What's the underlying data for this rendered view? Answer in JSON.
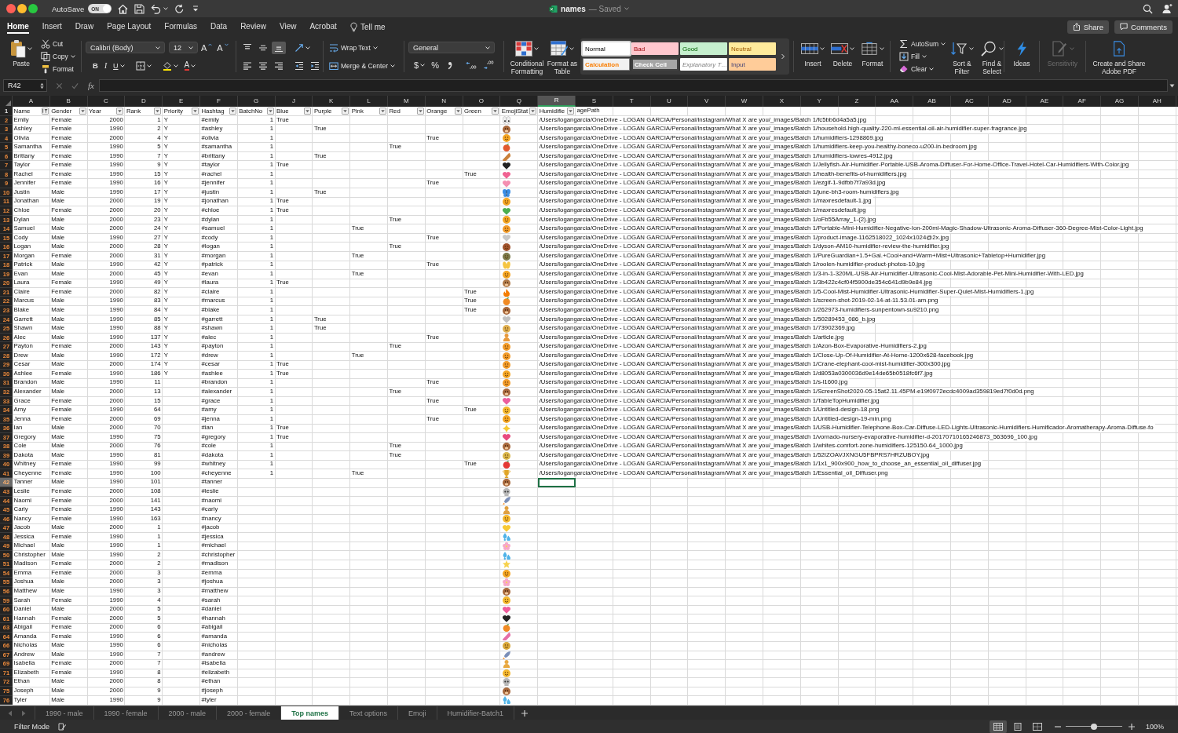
{
  "title_bar": {
    "autosave_label": "AutoSave",
    "autosave": {
      "label": "ON",
      "on": true
    },
    "document": "names",
    "status": "— Saved"
  },
  "ribbon_tabs": [
    {
      "label": "Home",
      "selected": true
    },
    {
      "label": "Insert",
      "selected": false
    },
    {
      "label": "Draw",
      "selected": false
    },
    {
      "label": "Page Layout",
      "selected": false
    },
    {
      "label": "Formulas",
      "selected": false
    },
    {
      "label": "Data",
      "selected": false
    },
    {
      "label": "Review",
      "selected": false
    },
    {
      "label": "View",
      "selected": false
    },
    {
      "label": "Acrobat",
      "selected": false
    }
  ],
  "tell_me": "Tell me",
  "share": "Share",
  "comments": "Comments",
  "clipboard": {
    "paste": "Paste",
    "cut": "Cut",
    "copy": "Copy",
    "format": "Format"
  },
  "font": {
    "name": "Calibri (Body)",
    "size": "12",
    "grow": "A",
    "shrink": "A",
    "bold": "B",
    "italic": "I",
    "underline": "U",
    "font_color_button": "A"
  },
  "alignment": {
    "vertical": [
      {
        "kind": "top",
        "selected": false
      },
      {
        "kind": "middle",
        "selected": false
      },
      {
        "kind": "bottom",
        "selected": true
      }
    ],
    "horizontal": [
      {
        "kind": "left",
        "selected": false
      },
      {
        "kind": "center",
        "selected": false
      },
      {
        "kind": "right",
        "selected": false
      }
    ],
    "wrap_text": "Wrap Text",
    "merge": "Merge & Center"
  },
  "number": {
    "format": "General",
    "currency": "$",
    "percent": "%"
  },
  "format_buttons": {
    "conditional": "Conditional Formatting",
    "table": "Format as Table"
  },
  "cell_styles": [
    {
      "label": "Normal",
      "kind": "normal",
      "selected": true
    },
    {
      "label": "Bad",
      "kind": "bad",
      "selected": false
    },
    {
      "label": "Good",
      "kind": "good",
      "selected": false
    },
    {
      "label": "Neutral",
      "kind": "neutral",
      "selected": false
    },
    {
      "label": "Calculation",
      "kind": "calculation",
      "selected": false
    },
    {
      "label": "Check Cell",
      "kind": "check",
      "selected": false
    },
    {
      "label": "Explanatory T…",
      "kind": "explanatory",
      "selected": false
    },
    {
      "label": "Input",
      "kind": "input",
      "selected": false
    }
  ],
  "cells": {
    "insert": "Insert",
    "delete": "Delete",
    "format": "Format"
  },
  "editing": {
    "autosum": "AutoSum",
    "fill": "Fill",
    "clear": "Clear",
    "sort": "Sort & Filter",
    "find": "Find & Select"
  },
  "tools": [
    {
      "label": "Ideas",
      "kind": "ideas",
      "disabled": false
    },
    {
      "label": "Sensitivity",
      "kind": "sensitivity",
      "disabled": true
    },
    {
      "label": "Create and Share Adobe PDF",
      "kind": "pdf",
      "disabled": false
    }
  ],
  "formula_bar": {
    "name_box": "R42",
    "fx": "fx",
    "edit_buttons_disabled": true
  },
  "columns": [
    {
      "label": "A",
      "selected": false
    },
    {
      "label": "B",
      "selected": false
    },
    {
      "label": "C",
      "selected": false
    },
    {
      "label": "D",
      "selected": false
    },
    {
      "label": "E",
      "selected": false
    },
    {
      "label": "F",
      "selected": false
    },
    {
      "label": "G",
      "selected": false
    },
    {
      "label": "J",
      "selected": false
    },
    {
      "label": "K",
      "selected": false
    },
    {
      "label": "L",
      "selected": false
    },
    {
      "label": "M",
      "selected": false
    },
    {
      "label": "N",
      "selected": false
    },
    {
      "label": "O",
      "selected": false
    },
    {
      "label": "Q",
      "selected": false
    },
    {
      "label": "R",
      "selected": true
    },
    {
      "label": "S",
      "selected": false
    },
    {
      "label": "T",
      "selected": false
    },
    {
      "label": "U",
      "selected": false
    },
    {
      "label": "V",
      "selected": false
    },
    {
      "label": "W",
      "selected": false
    },
    {
      "label": "X",
      "selected": false
    },
    {
      "label": "Y",
      "selected": false
    },
    {
      "label": "Z",
      "selected": false
    },
    {
      "label": "AA",
      "selected": false
    },
    {
      "label": "AB",
      "selected": false
    },
    {
      "label": "AC",
      "selected": false
    },
    {
      "label": "AD",
      "selected": false
    },
    {
      "label": "AE",
      "selected": false
    },
    {
      "label": "AF",
      "selected": false
    },
    {
      "label": "AG",
      "selected": false
    },
    {
      "label": "AH",
      "selected": false
    }
  ],
  "header_row": {
    "row": "1",
    "cells": [
      {
        "label": "Name",
        "filtered": true
      },
      {
        "label": "Gender",
        "filtered": false
      },
      {
        "label": "Year",
        "filtered": false
      },
      {
        "label": "Rank",
        "filtered": false
      },
      {
        "label": "Priority",
        "filtered": false
      },
      {
        "label": "Hashtag",
        "filtered": false
      },
      {
        "label": "BatchNo",
        "filtered": false
      },
      {
        "label": "Blue",
        "filtered": false
      },
      {
        "label": "Purple",
        "filtered": false
      },
      {
        "label": "Pink",
        "filtered": false
      },
      {
        "label": "Red",
        "filtered": false
      },
      {
        "label": "Orange",
        "filtered": false
      },
      {
        "label": "Green",
        "filtered": false
      },
      {
        "label": "EmojiStat",
        "filtered": false
      },
      {
        "label": "Humidifie",
        "filtered": false,
        "overflow": "agePath"
      }
    ]
  },
  "rows": [
    {
      "row": "2",
      "name": "Emily",
      "gender": "Female",
      "year": "2000",
      "rank": "1",
      "priority": "Y",
      "hashtag": "#emily",
      "batch_no": "1",
      "blue": "True",
      "emoji": {
        "kind": "eyes",
        "color": "#f2f2f2"
      },
      "image_path": "/Users/logangarcia/OneDrive - LOGAN GARCIA/Personal/Instagram/What X are you/_images/Batch 1/fc5bb6d4a5a5.jpg",
      "selected": false
    },
    {
      "row": "3",
      "name": "Ashley",
      "gender": "Female",
      "year": "1990",
      "rank": "2",
      "priority": "Y",
      "hashtag": "#ashley",
      "batch_no": "1",
      "purple": "True",
      "emoji": {
        "kind": "monkey",
        "color": "#a8683c"
      },
      "image_path": "/Users/logangarcia/OneDrive - LOGAN GARCIA/Personal/Instagram/What X are you/_images/Batch 1/household-high-quality-220-ml-essential-oil-air-humidifier-super-fragrance.jpg",
      "selected": false
    },
    {
      "row": "4",
      "name": "Olivia",
      "gender": "Female",
      "year": "2000",
      "rank": "4",
      "priority": "Y",
      "hashtag": "#olivia",
      "batch_no": "1",
      "orange": "True",
      "emoji": {
        "kind": "face",
        "color": "#f5a623"
      },
      "image_path": "/Users/logangarcia/OneDrive - LOGAN GARCIA/Personal/Instagram/What X are you/_images/Batch 1/humidifiers-1298869.jpg",
      "selected": false
    },
    {
      "row": "5",
      "name": "Samantha",
      "gender": "Female",
      "year": "1990",
      "rank": "5",
      "priority": "Y",
      "hashtag": "#samantha",
      "batch_no": "1",
      "red": "True",
      "emoji": {
        "kind": "fruit",
        "color": "#e25a2e"
      },
      "image_path": "/Users/logangarcia/OneDrive - LOGAN GARCIA/Personal/Instagram/What X are you/_images/Batch 1/humidifiers-keep-you-healthy-boneco-u200-in-bedroom.jpg",
      "selected": false
    },
    {
      "row": "6",
      "name": "Brittany",
      "gender": "Female",
      "year": "1990",
      "rank": "7",
      "priority": "Y",
      "hashtag": "#brittany",
      "batch_no": "1",
      "purple": "True",
      "emoji": {
        "kind": "sticks",
        "color": "#c9803a"
      },
      "image_path": "/Users/logangarcia/OneDrive - LOGAN GARCIA/Personal/Instagram/What X are you/_images/Batch 1/humidifiers-lowres-4912.jpg",
      "selected": false
    },
    {
      "row": "7",
      "name": "Taylor",
      "gender": "Female",
      "year": "1990",
      "rank": "9",
      "priority": "Y",
      "hashtag": "#taylor",
      "batch_no": "1",
      "blue": "True",
      "emoji": {
        "kind": "heart",
        "color": "#222222"
      },
      "image_path": "/Users/logangarcia/OneDrive - LOGAN GARCIA/Personal/Instagram/What X are you/_images/Batch 1/Jellyfish-Air-Humidifier-Portable-USB-Aroma-Diffuser-For-Home-Office-Travel-Hotel-Car-Humidifiers-With-Color.jpg",
      "selected": false
    },
    {
      "row": "8",
      "name": "Rachel",
      "gender": "Female",
      "year": "1990",
      "rank": "15",
      "priority": "Y",
      "hashtag": "#rachel",
      "batch_no": "1",
      "green": "True",
      "emoji": {
        "kind": "heart",
        "color": "#f06292"
      },
      "image_path": "/Users/logangarcia/OneDrive - LOGAN GARCIA/Personal/Instagram/What X are you/_images/Batch 1/health-benefits-of-humidifiers.jpg",
      "selected": false
    },
    {
      "row": "9",
      "name": "Jennifer",
      "gender": "Female",
      "year": "1990",
      "rank": "16",
      "priority": "Y",
      "hashtag": "#jennifer",
      "batch_no": "1",
      "orange": "True",
      "emoji": {
        "kind": "heart",
        "color": "#f48fb1"
      },
      "image_path": "/Users/logangarcia/OneDrive - LOGAN GARCIA/Personal/Instagram/What X are you/_images/Batch 1/ezgif-1-9dfbb7f7a93d.jpg",
      "selected": false
    },
    {
      "row": "10",
      "name": "Justin",
      "gender": "Male",
      "year": "1990",
      "rank": "17",
      "priority": "Y",
      "hashtag": "#justin",
      "batch_no": "1",
      "purple": "True",
      "emoji": {
        "kind": "butterfly",
        "color": "#3a8ee6"
      },
      "image_path": "/Users/logangarcia/OneDrive - LOGAN GARCIA/Personal/Instagram/What X are you/_images/Batch 1/june-bh3-room-humidifiers.jpg",
      "selected": false
    },
    {
      "row": "11",
      "name": "Jonathan",
      "gender": "Male",
      "year": "2000",
      "rank": "19",
      "priority": "Y",
      "hashtag": "#jonathan",
      "batch_no": "1",
      "blue": "True",
      "emoji": {
        "kind": "face",
        "color": "#f5a623"
      },
      "image_path": "/Users/logangarcia/OneDrive - LOGAN GARCIA/Personal/Instagram/What X are you/_images/Batch 1/maxresdefault-1.jpg",
      "selected": false
    },
    {
      "row": "12",
      "name": "Chloe",
      "gender": "Female",
      "year": "2000",
      "rank": "20",
      "priority": "Y",
      "hashtag": "#chloe",
      "batch_no": "1",
      "blue": "True",
      "emoji": {
        "kind": "heart",
        "color": "#4caf50"
      },
      "image_path": "/Users/logangarcia/OneDrive - LOGAN GARCIA/Personal/Instagram/What X are you/_images/Batch 1/maxresdefault.jpg",
      "selected": false
    },
    {
      "row": "13",
      "name": "Dylan",
      "gender": "Male",
      "year": "2000",
      "rank": "23",
      "priority": "Y",
      "hashtag": "#dylan",
      "batch_no": "1",
      "red": "True",
      "emoji": {
        "kind": "face",
        "color": "#f5a623"
      },
      "image_path": "/Users/logangarcia/OneDrive - LOGAN GARCIA/Personal/Instagram/What X are you/_images/Batch 1/oFb55Array_1-(2).jpg",
      "selected": false
    },
    {
      "row": "14",
      "name": "Samuel",
      "gender": "Male",
      "year": "2000",
      "rank": "24",
      "priority": "Y",
      "hashtag": "#samuel",
      "batch_no": "1",
      "pink": "True",
      "emoji": {
        "kind": "face",
        "color": "#f39c2a"
      },
      "image_path": "/Users/logangarcia/OneDrive - LOGAN GARCIA/Personal/Instagram/What X are you/_images/Batch 1/Portable-Mini-Humidifier-Negative-Ion-200ml-Magic-Shadow-Ultrasonic-Aroma-Diffuser-360-Degree-Mist-Color-Light.jpg",
      "selected": false
    },
    {
      "row": "15",
      "name": "Cody",
      "gender": "Male",
      "year": "1990",
      "rank": "27",
      "priority": "Y",
      "hashtag": "#cody",
      "batch_no": "1",
      "orange": "True",
      "emoji": {
        "kind": "heart",
        "color": "#c8c8c8"
      },
      "image_path": "/Users/logangarcia/OneDrive - LOGAN GARCIA/Personal/Instagram/What X are you/_images/Batch 1/product-image-1162518022_1024x1024@2x.jpg",
      "selected": false
    },
    {
      "row": "16",
      "name": "Logan",
      "gender": "Male",
      "year": "2000",
      "rank": "28",
      "priority": "Y",
      "hashtag": "#logan",
      "batch_no": "1",
      "red": "True",
      "emoji": {
        "kind": "face",
        "color": "#a0522d"
      },
      "image_path": "/Users/logangarcia/OneDrive - LOGAN GARCIA/Personal/Instagram/What X are you/_images/Batch 1/dyson-AM10-humidifier-review-the-humidifier.jpg",
      "selected": false
    },
    {
      "row": "17",
      "name": "Morgan",
      "gender": "Female",
      "year": "2000",
      "rank": "31",
      "priority": "Y",
      "hashtag": "#morgan",
      "batch_no": "1",
      "pink": "True",
      "emoji": {
        "kind": "face",
        "color": "#7a7a4a"
      },
      "image_path": "/Users/logangarcia/OneDrive - LOGAN GARCIA/Personal/Instagram/What X are you/_images/Batch 1/PureGuardian+1.5+Gal.+Cool+and+Warm+Mist+Ultrasonic+Tabletop+Humidifier.jpg",
      "selected": false
    },
    {
      "row": "18",
      "name": "Patrick",
      "gender": "Male",
      "year": "1990",
      "rank": "42",
      "priority": "Y",
      "hashtag": "#patrick",
      "batch_no": "1",
      "orange": "True",
      "emoji": {
        "kind": "hands",
        "color": "#f5c542"
      },
      "image_path": "/Users/logangarcia/OneDrive - LOGAN GARCIA/Personal/Instagram/What X are you/_images/Batch 1/roolen-humidifier-product-photos-10.jpg",
      "selected": false
    },
    {
      "row": "19",
      "name": "Evan",
      "gender": "Male",
      "year": "2000",
      "rank": "45",
      "priority": "Y",
      "hashtag": "#evan",
      "batch_no": "1",
      "pink": "True",
      "emoji": {
        "kind": "face",
        "color": "#f5a623"
      },
      "image_path": "/Users/logangarcia/OneDrive - LOGAN GARCIA/Personal/Instagram/What X are you/_images/Batch 1/3-in-1-320ML-USB-Air-Humidifier-Ultrasonic-Cool-Mist-Adorable-Pet-Mini-Humidifier-With-LED.jpg",
      "selected": false
    },
    {
      "row": "20",
      "name": "Laura",
      "gender": "Female",
      "year": "1990",
      "rank": "49",
      "priority": "Y",
      "hashtag": "#laura",
      "batch_no": "1",
      "blue": "True",
      "emoji": {
        "kind": "monkey",
        "color": "#b07a4a"
      },
      "image_path": "/Users/logangarcia/OneDrive - LOGAN GARCIA/Personal/Instagram/What X are you/_images/Batch 1/3b422c4cf04f5900de354c641d9b9e84.jpg",
      "selected": false
    },
    {
      "row": "21",
      "name": "Claire",
      "gender": "Female",
      "year": "2000",
      "rank": "82",
      "priority": "Y",
      "hashtag": "#claire",
      "batch_no": "1",
      "green": "True",
      "emoji": {
        "kind": "flame",
        "color": "#f57c00"
      },
      "image_path": "/Users/logangarcia/OneDrive - LOGAN GARCIA/Personal/Instagram/What X are you/_images/Batch 1/5-Cool-Mist-Humidifier-Ultrasonic-Humidifier-Super-Quiet-Mist-Humidifiers-1.jpg",
      "selected": false
    },
    {
      "row": "22",
      "name": "Marcus",
      "gender": "Male",
      "year": "1990",
      "rank": "83",
      "priority": "Y",
      "hashtag": "#marcus",
      "batch_no": "1",
      "green": "True",
      "emoji": {
        "kind": "fruit",
        "color": "#f08a24"
      },
      "image_path": "/Users/logangarcia/OneDrive - LOGAN GARCIA/Personal/Instagram/What X are you/_images/Batch 1/screen-shot-2019-02-14-at-11.53.01-am.png",
      "selected": false
    },
    {
      "row": "23",
      "name": "Blake",
      "gender": "Male",
      "year": "1990",
      "rank": "84",
      "priority": "Y",
      "hashtag": "#blake",
      "batch_no": "1",
      "green": "True",
      "emoji": {
        "kind": "monkey",
        "color": "#a8683c"
      },
      "image_path": "/Users/logangarcia/OneDrive - LOGAN GARCIA/Personal/Instagram/What X are you/_images/Batch 1/262973-humidifiers-sunpentown-su9210.png",
      "selected": false
    },
    {
      "row": "24",
      "name": "Garrett",
      "gender": "Male",
      "year": "1990",
      "rank": "85",
      "priority": "Y",
      "hashtag": "#garrett",
      "batch_no": "1",
      "purple": "True",
      "emoji": {
        "kind": "heart",
        "color": "#c0c0c0"
      },
      "image_path": "/Users/logangarcia/OneDrive - LOGAN GARCIA/Personal/Instagram/What X are you/_images/Batch 1/50289453_086_b.jpg",
      "selected": false
    },
    {
      "row": "25",
      "name": "Shawn",
      "gender": "Male",
      "year": "1990",
      "rank": "88",
      "priority": "Y",
      "hashtag": "#shawn",
      "batch_no": "1",
      "purple": "True",
      "emoji": {
        "kind": "face",
        "color": "#e0b050"
      },
      "image_path": "/Users/logangarcia/OneDrive - LOGAN GARCIA/Personal/Instagram/What X are you/_images/Batch 1/73902369.jpg",
      "selected": false
    },
    {
      "row": "26",
      "name": "Alec",
      "gender": "Male",
      "year": "1990",
      "rank": "137",
      "priority": "Y",
      "hashtag": "#alec",
      "batch_no": "1",
      "orange": "True",
      "emoji": {
        "kind": "person",
        "color": "#e89a3c"
      },
      "image_path": "/Users/logangarcia/OneDrive - LOGAN GARCIA/Personal/Instagram/What X are you/_images/Batch 1/article.jpg",
      "selected": false
    },
    {
      "row": "27",
      "name": "Payton",
      "gender": "Female",
      "year": "2000",
      "rank": "143",
      "priority": "Y",
      "hashtag": "#payton",
      "batch_no": "1",
      "red": "True",
      "emoji": {
        "kind": "face",
        "color": "#f39c2a"
      },
      "image_path": "/Users/logangarcia/OneDrive - LOGAN GARCIA/Personal/Instagram/What X are you/_images/Batch 1/Azon-Box-Evaporative-Humidifiers-2.jpg",
      "selected": false
    },
    {
      "row": "28",
      "name": "Drew",
      "gender": "Male",
      "year": "1990",
      "rank": "172",
      "priority": "Y",
      "hashtag": "#drew",
      "batch_no": "1",
      "pink": "True",
      "emoji": {
        "kind": "face",
        "color": "#f39c2a"
      },
      "image_path": "/Users/logangarcia/OneDrive - LOGAN GARCIA/Personal/Instagram/What X are you/_images/Batch 1/Close-Up-Of-Humidifier-At-Home-1200x628-facebook.jpg",
      "selected": false
    },
    {
      "row": "29",
      "name": "Cesar",
      "gender": "Male",
      "year": "2000",
      "rank": "174",
      "priority": "Y",
      "hashtag": "#cesar",
      "batch_no": "1",
      "blue": "True",
      "emoji": {
        "kind": "face",
        "color": "#f39c2a"
      },
      "image_path": "/Users/logangarcia/OneDrive - LOGAN GARCIA/Personal/Instagram/What X are you/_images/Batch 1/Crane-elephant-cool-mist-humidifier-300x300.jpg",
      "selected": false
    },
    {
      "row": "30",
      "name": "Ashlee",
      "gender": "Female",
      "year": "1990",
      "rank": "186",
      "priority": "Y",
      "hashtag": "#ashlee",
      "batch_no": "1",
      "blue": "True",
      "emoji": {
        "kind": "face",
        "color": "#f5a623"
      },
      "image_path": "/Users/logangarcia/OneDrive - LOGAN GARCIA/Personal/Instagram/What X are you/_images/Batch 1/d8053a0300036d9e14de65b0518fc6f7.jpg",
      "selected": false
    },
    {
      "row": "31",
      "name": "Brandon",
      "gender": "Male",
      "year": "1990",
      "rank": "11",
      "hashtag": "#brandon",
      "batch_no": "1",
      "orange": "True",
      "emoji": {
        "kind": "face",
        "color": "#f39c2a"
      },
      "image_path": "/Users/logangarcia/OneDrive - LOGAN GARCIA/Personal/Instagram/What X are you/_images/Batch 1/s-l1600.jpg",
      "selected": false
    },
    {
      "row": "32",
      "name": "Alexander",
      "gender": "Male",
      "year": "2000",
      "rank": "13",
      "hashtag": "#alexander",
      "batch_no": "1",
      "red": "True",
      "emoji": {
        "kind": "monkey",
        "color": "#a8683c"
      },
      "image_path": "/Users/logangarcia/OneDrive - LOGAN GARCIA/Personal/Instagram/What X are you/_images/Batch 1/ScreenShot2020-05-15at2.11.45PM-e19f0972ecdc4009ad359819ed7f0d0d.png",
      "selected": false
    },
    {
      "row": "33",
      "name": "Grace",
      "gender": "Female",
      "year": "2000",
      "rank": "15",
      "hashtag": "#grace",
      "batch_no": "1",
      "orange": "True",
      "emoji": {
        "kind": "heart",
        "color": "#ec5fa0"
      },
      "image_path": "/Users/logangarcia/OneDrive - LOGAN GARCIA/Personal/Instagram/What X are you/_images/Batch 1/TableTopHumidifier.jpg",
      "selected": false
    },
    {
      "row": "34",
      "name": "Amy",
      "gender": "Female",
      "year": "1990",
      "rank": "64",
      "hashtag": "#amy",
      "batch_no": "1",
      "green": "True",
      "emoji": {
        "kind": "face",
        "color": "#f5b82e"
      },
      "image_path": "/Users/logangarcia/OneDrive - LOGAN GARCIA/Personal/Instagram/What X are you/_images/Batch 1/Untitled-design-18.png",
      "selected": false
    },
    {
      "row": "35",
      "name": "Jenna",
      "gender": "Female",
      "year": "2000",
      "rank": "69",
      "hashtag": "#jenna",
      "batch_no": "1",
      "orange": "True",
      "emoji": {
        "kind": "face",
        "color": "#f5a623"
      },
      "image_path": "/Users/logangarcia/OneDrive - LOGAN GARCIA/Personal/Instagram/What X are you/_images/Batch 1/Untitled-design-19-min.png",
      "selected": false
    },
    {
      "row": "36",
      "name": "Ian",
      "gender": "Male",
      "year": "2000",
      "rank": "70",
      "hashtag": "#ian",
      "batch_no": "1",
      "blue": "True",
      "emoji": {
        "kind": "sparkle",
        "color": "#f7c934"
      },
      "image_path": "/Users/logangarcia/OneDrive - LOGAN GARCIA/Personal/Instagram/What X are you/_images/Batch 1/USB-Humidifier-Telephone-Box-Car-Diffuse-LED-Lights-Ultrasonic-Humidifiers-Humificador-Aromatherapy-Aroma-Diffuse-fo",
      "selected": false
    },
    {
      "row": "37",
      "name": "Gregory",
      "gender": "Male",
      "year": "1990",
      "rank": "75",
      "hashtag": "#gregory",
      "batch_no": "1",
      "blue": "True",
      "emoji": {
        "kind": "heart",
        "color": "#e84a7f"
      },
      "image_path": "/Users/logangarcia/OneDrive - LOGAN GARCIA/Personal/Instagram/What X are you/_images/Batch 1/vornado-nursery-evaporative-humidifier-d-20170710165246873_563696_100.jpg",
      "selected": false
    },
    {
      "row": "38",
      "name": "Cole",
      "gender": "Male",
      "year": "2000",
      "rank": "76",
      "hashtag": "#cole",
      "batch_no": "1",
      "red": "True",
      "emoji": {
        "kind": "monkey",
        "color": "#a8683c"
      },
      "image_path": "/Users/logangarcia/OneDrive - LOGAN GARCIA/Personal/Instagram/What X are you/_images/Batch 1/whites-comfort-zone-humidifiers-125150-64_1000.jpg",
      "selected": false
    },
    {
      "row": "39",
      "name": "Dakota",
      "gender": "Male",
      "year": "1990",
      "rank": "81",
      "hashtag": "#dakota",
      "batch_no": "1",
      "red": "True",
      "emoji": {
        "kind": "face",
        "color": "#d9b64a"
      },
      "image_path": "/Users/logangarcia/OneDrive - LOGAN GARCIA/Personal/Instagram/What X are you/_images/Batch 1/52IZOAVJXNGU5FBPRS7HRZUBOY.jpg",
      "selected": false
    },
    {
      "row": "40",
      "name": "Whitney",
      "gender": "Female",
      "year": "1990",
      "rank": "99",
      "hashtag": "#whitney",
      "batch_no": "1",
      "green": "True",
      "emoji": {
        "kind": "fruit",
        "color": "#e53935"
      },
      "image_path": "/Users/logangarcia/OneDrive - LOGAN GARCIA/Personal/Instagram/What X are you/_images/Batch 1/1x1_900x900_how_to_choose_an_essential_oil_diffuser.jpg",
      "selected": false
    },
    {
      "row": "41",
      "name": "Cheyenne",
      "gender": "Female",
      "year": "1990",
      "rank": "100",
      "hashtag": "#cheyenne",
      "batch_no": "1",
      "pink": "True",
      "emoji": {
        "kind": "trophy",
        "color": "#e0a526"
      },
      "image_path": "/Users/logangarcia/OneDrive - LOGAN GARCIA/Personal/Instagram/What X are you/_images/Batch 1/Essential_oil_Diffuser.png",
      "selected": false
    },
    {
      "row": "42",
      "name": "Tanner",
      "gender": "Male",
      "year": "1990",
      "rank": "101",
      "hashtag": "#tanner",
      "emoji": {
        "kind": "monkey",
        "color": "#a8683c"
      },
      "selected": true
    },
    {
      "row": "43",
      "name": "Leslie",
      "gender": "Female",
      "year": "2000",
      "rank": "108",
      "hashtag": "#leslie",
      "emoji": {
        "kind": "skull",
        "color": "#b8b8b8"
      },
      "selected": false
    },
    {
      "row": "44",
      "name": "Naomi",
      "gender": "Female",
      "year": "2000",
      "rank": "141",
      "hashtag": "#naomi",
      "emoji": {
        "kind": "rocket",
        "color": "#7b8fb8"
      },
      "selected": false
    },
    {
      "row": "45",
      "name": "Carly",
      "gender": "Female",
      "year": "1990",
      "rank": "143",
      "hashtag": "#carly",
      "emoji": {
        "kind": "person",
        "color": "#e0a040"
      },
      "selected": false
    },
    {
      "row": "46",
      "name": "Nancy",
      "gender": "Female",
      "year": "1990",
      "rank": "163",
      "hashtag": "#nancy",
      "emoji": {
        "kind": "face",
        "color": "#f5b82e"
      },
      "selected": false
    },
    {
      "row": "47",
      "name": "Jacob",
      "gender": "Male",
      "year": "2000",
      "rank": "1",
      "hashtag": "#jacob",
      "emoji": {
        "kind": "heart",
        "color": "#f7c934"
      },
      "selected": false
    },
    {
      "row": "48",
      "name": "Jessica",
      "gender": "Female",
      "year": "1990",
      "rank": "1",
      "hashtag": "#jessica",
      "emoji": {
        "kind": "droplets",
        "color": "#4fb3e8"
      },
      "selected": false
    },
    {
      "row": "49",
      "name": "Michael",
      "gender": "Male",
      "year": "1990",
      "rank": "1",
      "hashtag": "#michael",
      "emoji": {
        "kind": "flower",
        "color": "#f7a8c8"
      },
      "selected": false
    },
    {
      "row": "50",
      "name": "Christopher",
      "gender": "Male",
      "year": "1990",
      "rank": "2",
      "hashtag": "#christopher",
      "emoji": {
        "kind": "droplets",
        "color": "#4fb3e8"
      },
      "selected": false
    },
    {
      "row": "51",
      "name": "Madison",
      "gender": "Female",
      "year": "2000",
      "rank": "2",
      "hashtag": "#madison",
      "emoji": {
        "kind": "star",
        "color": "#f7d24c"
      },
      "selected": false
    },
    {
      "row": "54",
      "name": "Emma",
      "gender": "Female",
      "year": "2000",
      "rank": "3",
      "hashtag": "#emma",
      "emoji": {
        "kind": "face",
        "color": "#f5a623"
      },
      "selected": false
    },
    {
      "row": "55",
      "name": "Joshua",
      "gender": "Male",
      "year": "2000",
      "rank": "3",
      "hashtag": "#joshua",
      "emoji": {
        "kind": "flower",
        "color": "#f7a8c8"
      },
      "selected": false
    },
    {
      "row": "56",
      "name": "Matthew",
      "gender": "Male",
      "year": "1990",
      "rank": "3",
      "hashtag": "#matthew",
      "emoji": {
        "kind": "monkey",
        "color": "#a8683c"
      },
      "selected": false
    },
    {
      "row": "59",
      "name": "Sarah",
      "gender": "Female",
      "year": "1990",
      "rank": "4",
      "hashtag": "#sarah",
      "emoji": {
        "kind": "face",
        "color": "#f5b82e"
      },
      "selected": false
    },
    {
      "row": "60",
      "name": "Daniel",
      "gender": "Male",
      "year": "2000",
      "rank": "5",
      "hashtag": "#daniel",
      "emoji": {
        "kind": "heart",
        "color": "#ef5c9c"
      },
      "selected": false
    },
    {
      "row": "61",
      "name": "Hannah",
      "gender": "Female",
      "year": "2000",
      "rank": "5",
      "hashtag": "#hannah",
      "emoji": {
        "kind": "heart",
        "color": "#222222"
      },
      "selected": false
    },
    {
      "row": "63",
      "name": "Abigail",
      "gender": "Female",
      "year": "2000",
      "rank": "6",
      "hashtag": "#abigail",
      "emoji": {
        "kind": "fruit",
        "color": "#f08a24"
      },
      "selected": false
    },
    {
      "row": "64",
      "name": "Amanda",
      "gender": "Female",
      "year": "1990",
      "rank": "6",
      "hashtag": "#amanda",
      "emoji": {
        "kind": "sticks",
        "color": "#e56fa8"
      },
      "selected": false
    },
    {
      "row": "66",
      "name": "Nicholas",
      "gender": "Male",
      "year": "1990",
      "rank": "6",
      "hashtag": "#nicholas",
      "emoji": {
        "kind": "face",
        "color": "#d9a83a"
      },
      "selected": false
    },
    {
      "row": "67",
      "name": "Andrew",
      "gender": "Male",
      "year": "1990",
      "rank": "7",
      "hashtag": "#andrew",
      "emoji": {
        "kind": "rocket",
        "color": "#7b8fb8"
      },
      "selected": false
    },
    {
      "row": "69",
      "name": "Isabella",
      "gender": "Female",
      "year": "2000",
      "rank": "7",
      "hashtag": "#isabella",
      "emoji": {
        "kind": "person",
        "color": "#e8a840"
      },
      "selected": false
    },
    {
      "row": "71",
      "name": "Elizabeth",
      "gender": "Female",
      "year": "1990",
      "rank": "8",
      "hashtag": "#elizabeth",
      "emoji": {
        "kind": "face",
        "color": "#f5b82e"
      },
      "selected": false
    },
    {
      "row": "72",
      "name": "Ethan",
      "gender": "Male",
      "year": "2000",
      "rank": "8",
      "hashtag": "#ethan",
      "emoji": {
        "kind": "skull",
        "color": "#b8b8b8"
      },
      "selected": false
    },
    {
      "row": "75",
      "name": "Joseph",
      "gender": "Male",
      "year": "2000",
      "rank": "9",
      "hashtag": "#joseph",
      "emoji": {
        "kind": "monkey",
        "color": "#a8683c"
      },
      "selected": false
    },
    {
      "row": "76",
      "name": "Tyler",
      "gender": "Male",
      "year": "1990",
      "rank": "9",
      "hashtag": "#tyler",
      "emoji": {
        "kind": "droplets",
        "color": "#4fb3e8"
      },
      "selected": false
    }
  ],
  "sheet_tabs": [
    {
      "label": "1990 - male",
      "selected": false
    },
    {
      "label": "1990 - female",
      "selected": false
    },
    {
      "label": "2000 - male",
      "selected": false
    },
    {
      "label": "2000 - female",
      "selected": false
    },
    {
      "label": "Top names",
      "selected": true
    },
    {
      "label": "Text options",
      "selected": false
    },
    {
      "label": "Emoji",
      "selected": false
    },
    {
      "label": "Humidifier-Batch1",
      "selected": false
    }
  ],
  "status_bar": {
    "mode": "Filter Mode",
    "views": [
      {
        "kind": "normal",
        "selected": true
      },
      {
        "kind": "page_layout",
        "selected": false
      },
      {
        "kind": "page_break",
        "selected": false
      }
    ],
    "zoom": {
      "level": 0.5,
      "reading": "100%"
    }
  }
}
